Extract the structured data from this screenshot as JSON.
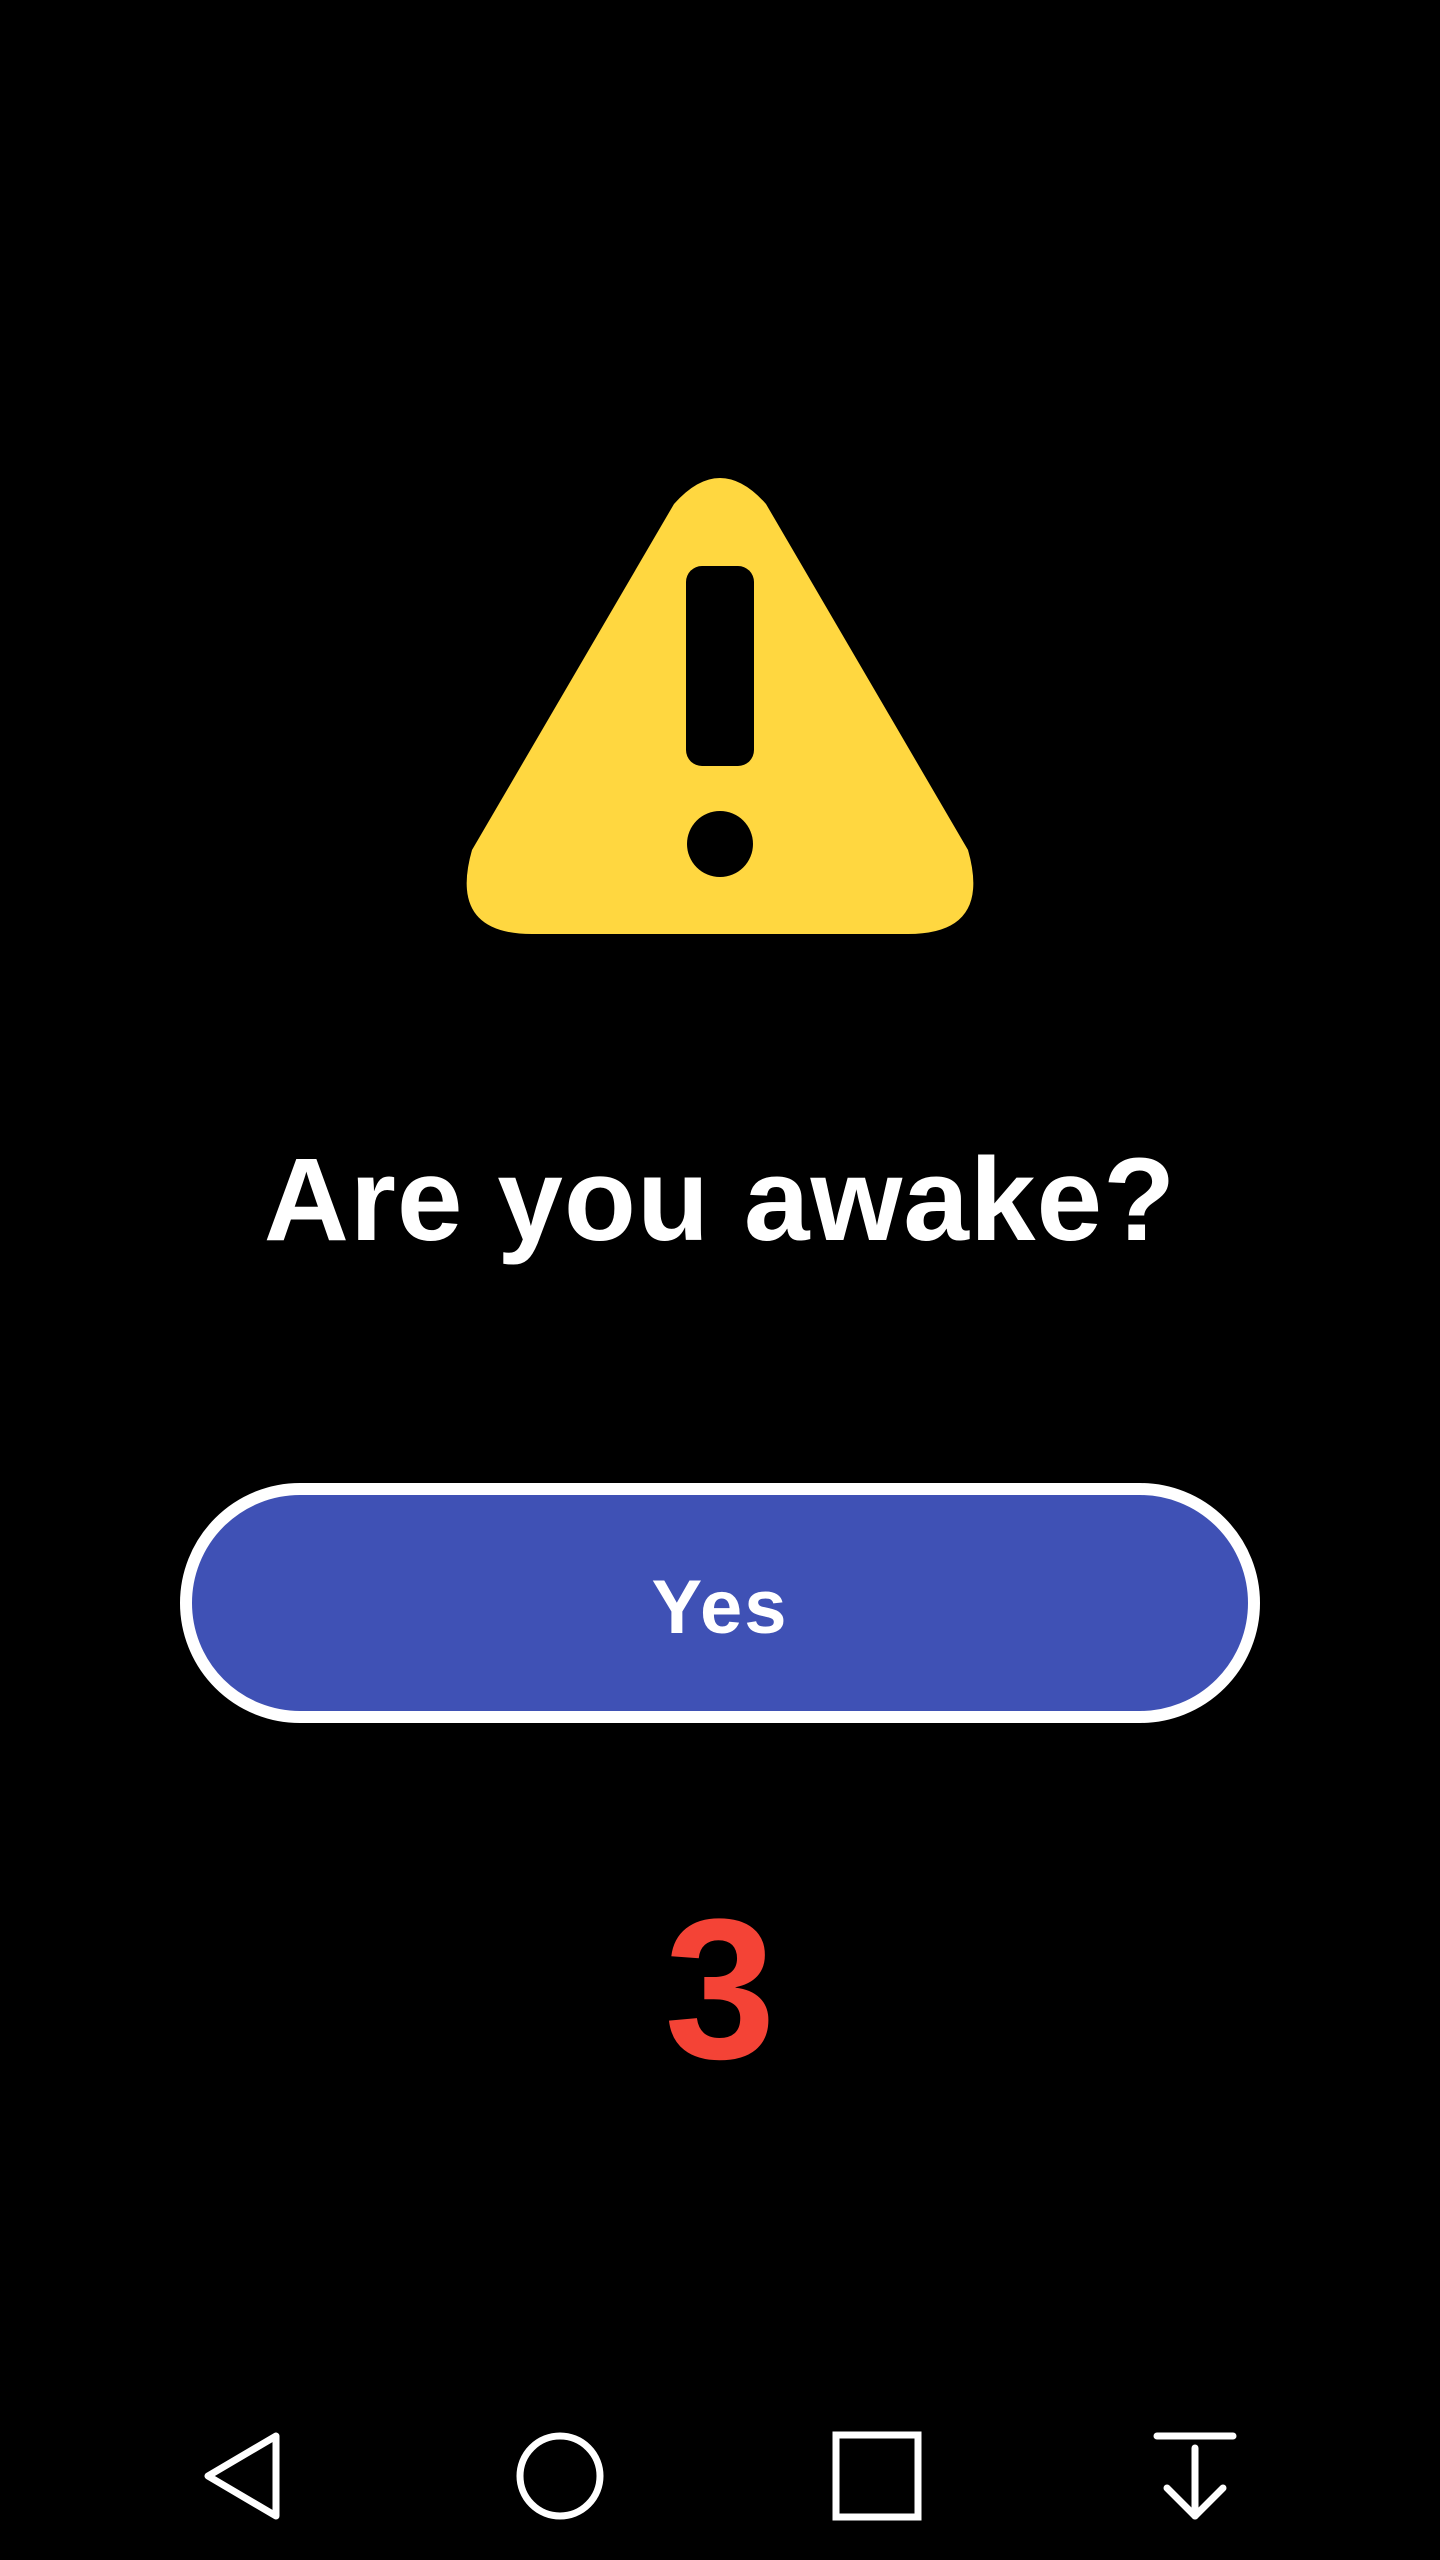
{
  "dialog": {
    "icon": "warning-icon",
    "title": "Are you awake?",
    "confirm_label": "Yes",
    "countdown": "3"
  },
  "navbar": {
    "items": [
      {
        "name": "back",
        "icon": "back-triangle-icon"
      },
      {
        "name": "home",
        "icon": "home-circle-icon"
      },
      {
        "name": "recents",
        "icon": "recents-square-icon"
      },
      {
        "name": "dismiss",
        "icon": "download-arrow-icon"
      }
    ]
  },
  "colors": {
    "background": "#000000",
    "warning": "#FFD740",
    "button": "#3F51B5",
    "button_border": "#FFFFFF",
    "countdown": "#F44336",
    "text": "#FFFFFF"
  }
}
